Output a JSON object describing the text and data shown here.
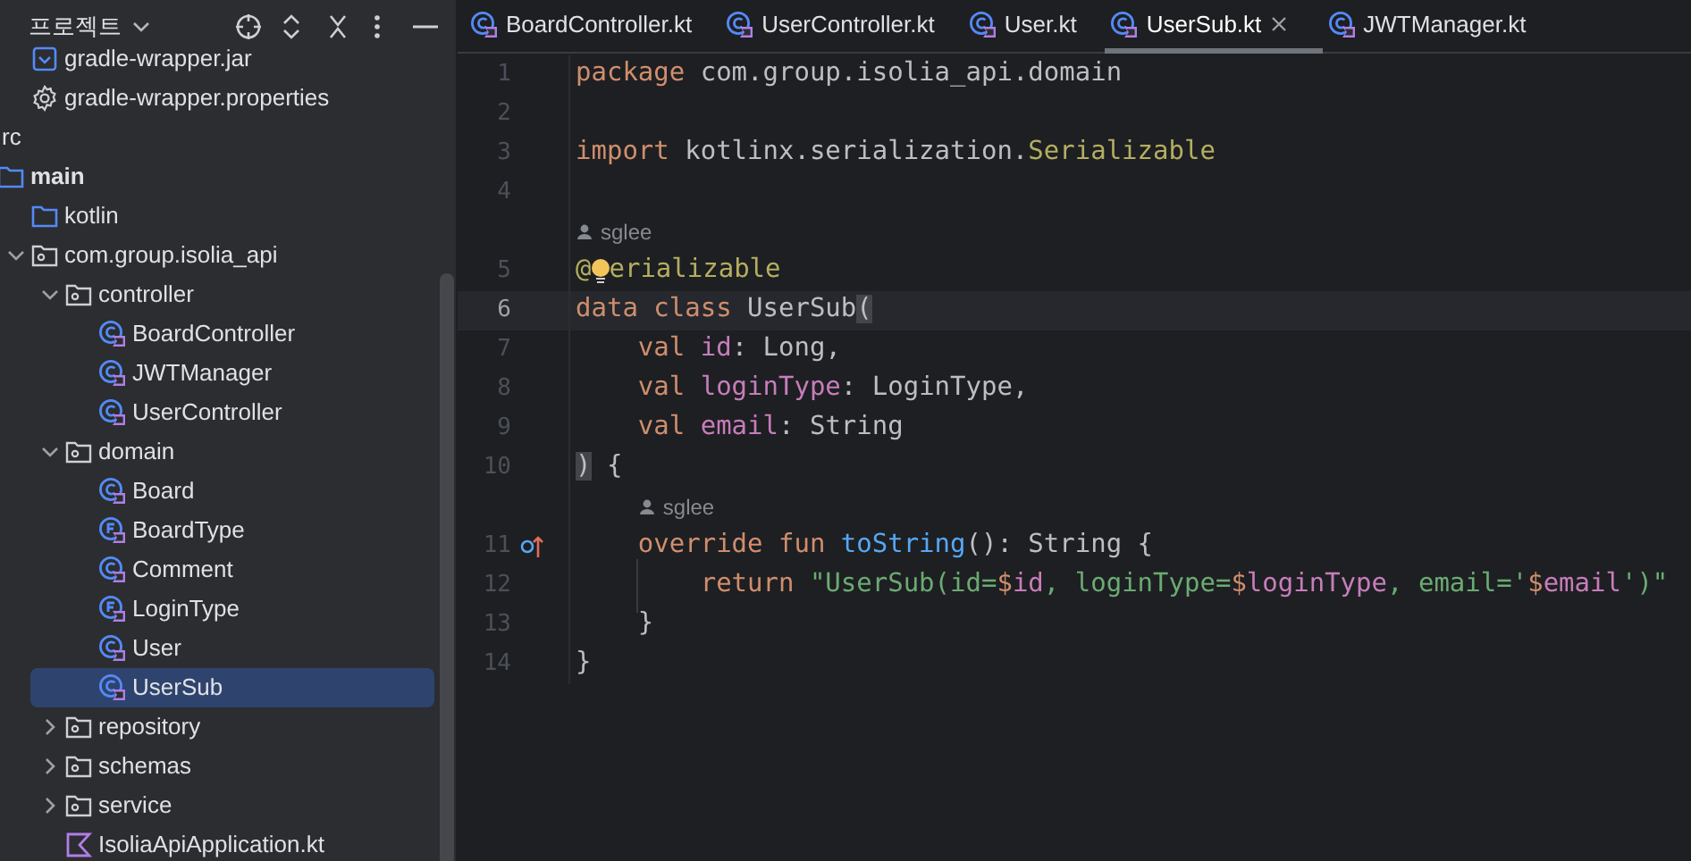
{
  "sidebar": {
    "title": "프로젝트",
    "files_above": [
      {
        "label": "gradle-wrapper.jar",
        "kind": "jar",
        "selected": false
      },
      {
        "label": "gradle-wrapper.properties",
        "kind": "settings",
        "selected": false
      }
    ],
    "tree": [
      {
        "label": "rc",
        "selected": false,
        "children": [
          {
            "label": "main",
            "kind": "source",
            "bold": true,
            "selected": false,
            "children": [
              {
                "label": "kotlin",
                "kind": "folder",
                "selected": false
              },
              {
                "label": "com.group.isolia_api",
                "kind": "package",
                "expanded": true,
                "selected": false,
                "children": [
                  {
                    "label": "controller",
                    "kind": "package",
                    "expanded": true,
                    "selected": false,
                    "children": [
                      {
                        "label": "BoardController",
                        "kind": "class",
                        "selected": false
                      },
                      {
                        "label": "JWTManager",
                        "kind": "class",
                        "selected": false
                      },
                      {
                        "label": "UserController",
                        "kind": "class",
                        "selected": false
                      }
                    ]
                  },
                  {
                    "label": "domain",
                    "kind": "package",
                    "expanded": true,
                    "selected": false,
                    "children": [
                      {
                        "label": "Board",
                        "kind": "class",
                        "selected": false
                      },
                      {
                        "label": "BoardType",
                        "kind": "enum",
                        "selected": false
                      },
                      {
                        "label": "Comment",
                        "kind": "class",
                        "selected": false
                      },
                      {
                        "label": "LoginType",
                        "kind": "enum",
                        "selected": false
                      },
                      {
                        "label": "User",
                        "kind": "class",
                        "selected": false
                      },
                      {
                        "label": "UserSub",
                        "kind": "class",
                        "selected": true
                      }
                    ]
                  },
                  {
                    "label": "repository",
                    "kind": "package",
                    "expanded": false,
                    "selected": false
                  },
                  {
                    "label": "schemas",
                    "kind": "package",
                    "expanded": false,
                    "selected": false
                  },
                  {
                    "label": "service",
                    "kind": "package",
                    "expanded": false,
                    "selected": false
                  },
                  {
                    "label": "IsoliaApiApplication.kt",
                    "kind": "kotlin",
                    "selected": false
                  }
                ]
              }
            ]
          }
        ]
      }
    ]
  },
  "tabs": [
    {
      "label": "BoardController.kt",
      "selected": false
    },
    {
      "label": "UserController.kt",
      "selected": false
    },
    {
      "label": "User.kt",
      "selected": false
    },
    {
      "label": "UserSub.kt",
      "selected": true
    },
    {
      "label": "JWTManager.kt",
      "selected": false
    }
  ],
  "editor": {
    "lines": [
      {
        "kind": "code",
        "number": "1",
        "tokens": [
          {
            "kind": "kw",
            "s": "package "
          },
          {
            "kind": "plain",
            "s": "com.group.isolia_api.domain"
          }
        ]
      },
      {
        "kind": "code",
        "number": "2"
      },
      {
        "kind": "code",
        "number": "3",
        "tokens": [
          {
            "kind": "kw",
            "s": "import "
          },
          {
            "kind": "plain",
            "s": "kotlinx.serialization."
          },
          {
            "kind": "anno",
            "s": "Serializable"
          }
        ]
      },
      {
        "kind": "code",
        "number": "4"
      },
      {
        "kind": "author",
        "text": "sglee"
      },
      {
        "kind": "code",
        "number": "5",
        "tokens": [
          {
            "kind": "anno",
            "s": "@"
          },
          {
            "kind": "bulb"
          },
          {
            "kind": "anno",
            "s": "erializable"
          }
        ]
      },
      {
        "kind": "code",
        "number": "6",
        "current": true,
        "tokens": [
          {
            "kind": "kw",
            "s": "data class "
          },
          {
            "kind": "plain",
            "s": "UserSub"
          },
          {
            "kind": "bracket",
            "s": "("
          }
        ]
      },
      {
        "kind": "code",
        "number": "7",
        "tokens": [
          {
            "kind": "kw",
            "s": "    val "
          },
          {
            "kind": "prop",
            "s": "id"
          },
          {
            "kind": "plain",
            "s": ": Long,"
          }
        ]
      },
      {
        "kind": "code",
        "number": "8",
        "tokens": [
          {
            "kind": "kw",
            "s": "    val "
          },
          {
            "kind": "prop",
            "s": "loginType"
          },
          {
            "kind": "plain",
            "s": ": LoginType,"
          }
        ]
      },
      {
        "kind": "code",
        "number": "9",
        "tokens": [
          {
            "kind": "kw",
            "s": "    val "
          },
          {
            "kind": "prop",
            "s": "email"
          },
          {
            "kind": "plain",
            "s": ": String"
          }
        ]
      },
      {
        "kind": "code",
        "number": "10",
        "tokens": [
          {
            "kind": "bracket",
            "s": ")"
          },
          {
            "kind": "plain",
            "s": " {"
          }
        ]
      },
      {
        "kind": "author",
        "text": "sglee"
      },
      {
        "kind": "code",
        "number": "11",
        "override_marker": true,
        "tokens": [
          {
            "kind": "kw",
            "s": "    override fun "
          },
          {
            "kind": "fn",
            "s": "toString"
          },
          {
            "kind": "plain",
            "s": "(): String {"
          }
        ]
      },
      {
        "kind": "code",
        "number": "12",
        "tokens": [
          {
            "kind": "kw",
            "s": "        return "
          },
          {
            "kind": "str",
            "s": "\"UserSub(id="
          },
          {
            "kind": "tpl",
            "s": "$"
          },
          {
            "kind": "prop",
            "s": "id"
          },
          {
            "kind": "str",
            "s": ", loginType="
          },
          {
            "kind": "tpl",
            "s": "$"
          },
          {
            "kind": "prop",
            "s": "loginType"
          },
          {
            "kind": "str",
            "s": ", email='"
          },
          {
            "kind": "tpl",
            "s": "$"
          },
          {
            "kind": "prop",
            "s": "email"
          },
          {
            "kind": "str",
            "s": "')\""
          }
        ]
      },
      {
        "kind": "code",
        "number": "13",
        "tokens": [
          {
            "kind": "plain",
            "s": "    }"
          }
        ]
      },
      {
        "kind": "code",
        "number": "14",
        "tokens": [
          {
            "kind": "plain",
            "s": "}"
          }
        ]
      }
    ]
  }
}
